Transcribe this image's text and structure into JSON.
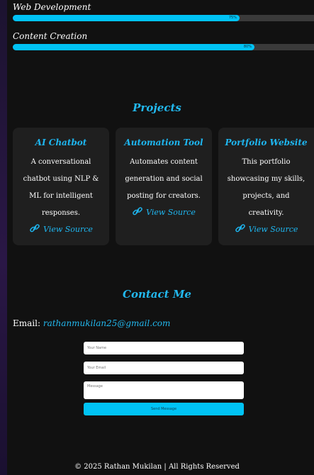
{
  "skills": [
    {
      "label": "Web Development",
      "percent": 75,
      "percent_text": "75%"
    },
    {
      "label": "Content Creation",
      "percent": 80,
      "percent_text": "80%"
    }
  ],
  "projects": {
    "heading": "Projects",
    "cards": [
      {
        "title": "AI Chatbot",
        "desc_lines": [
          "A conversational",
          "chatbot using NLP &",
          "ML for intelligent",
          "responses."
        ],
        "link_label": "View Source"
      },
      {
        "title": "Automation Tool",
        "desc_lines": [
          "Automates content",
          "generation and social",
          "posting for creators."
        ],
        "link_label": "View Source"
      },
      {
        "title": "Portfolio Website",
        "desc_lines": [
          "This portfolio",
          "showcasing my skills,",
          "projects, and",
          "creativity."
        ],
        "link_label": "View Source"
      }
    ]
  },
  "contact": {
    "heading": "Contact Me",
    "email_label": "Email:",
    "email": "rathanmukilan25@gmail.com",
    "name_placeholder": "Your Name",
    "email_placeholder": "Your Email",
    "message_placeholder": "Message",
    "send_label": "Send Message"
  },
  "footer": {
    "text": "© 2025 Rathan Mukilan | All Rights Reserved"
  },
  "colors": {
    "accent": "#00c3f5",
    "heading": "#22b8ee",
    "card_bg": "#1f1f1f",
    "track": "#3a3a3a"
  },
  "icons": {
    "link": "link-icon"
  }
}
